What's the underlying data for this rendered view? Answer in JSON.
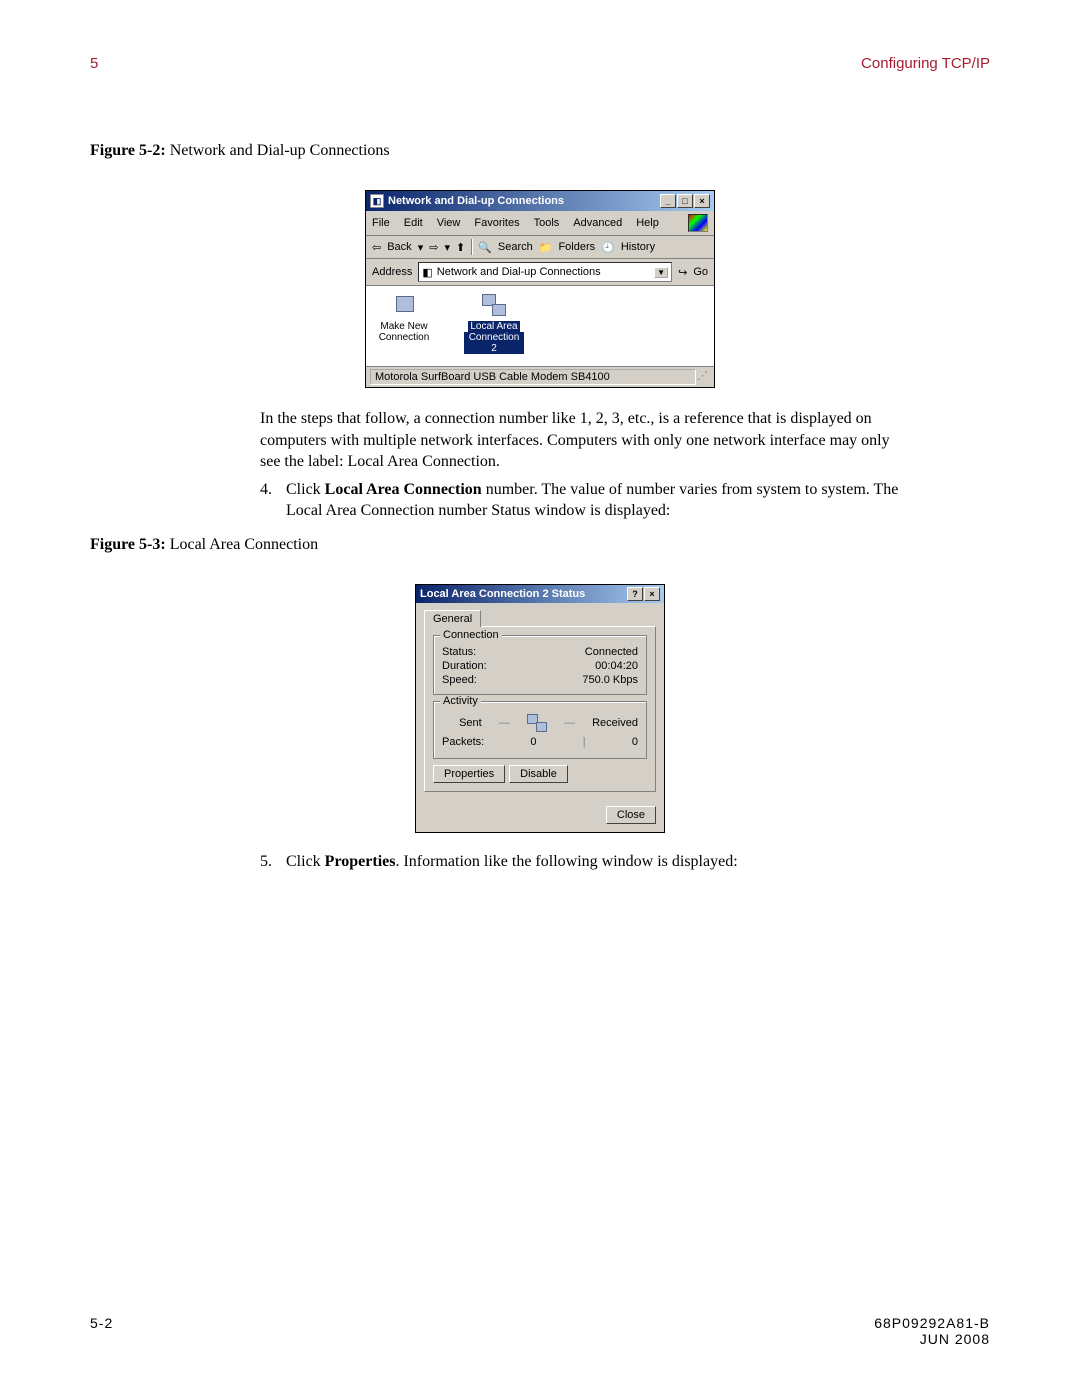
{
  "header": {
    "chapter": "5",
    "title": "Configuring TCP/IP"
  },
  "fig1_caption": {
    "label": "Figure 5-2:",
    "text": "Network and Dial-up Connections"
  },
  "win1": {
    "title": "Network and Dial-up Connections",
    "menu": [
      "File",
      "Edit",
      "View",
      "Favorites",
      "Tools",
      "Advanced",
      "Help"
    ],
    "toolbar": {
      "back": "Back",
      "search": "Search",
      "folders": "Folders",
      "history": "History"
    },
    "addr_label": "Address",
    "addr_value": "Network and Dial-up Connections",
    "go": "Go",
    "items": [
      {
        "line1": "Make New",
        "line2": "Connection"
      },
      {
        "line1": "Local Area",
        "line2": "Connection 2"
      }
    ],
    "status": "Motorola SurfBoard USB Cable Modem SB4100"
  },
  "para1": "In the steps that follow, a connection number like 1, 2, 3, etc., is a reference that is displayed on computers with multiple network interfaces. Computers with only one network interface may only see the label: Local Area Connection.",
  "step4": {
    "num": "4.",
    "pre": "Click ",
    "bold": "Local Area Connection",
    "post": " number. The value of number varies from system to system. The Local Area Connection number Status window is displayed:"
  },
  "fig2_caption": {
    "label": "Figure 5-3:",
    "text": "Local Area Connection"
  },
  "dlg": {
    "title": "Local Area Connection 2 Status",
    "tab": "General",
    "grp_conn": "Connection",
    "status_k": "Status:",
    "status_v": "Connected",
    "duration_k": "Duration:",
    "duration_v": "00:04:20",
    "speed_k": "Speed:",
    "speed_v": "750.0 Kbps",
    "grp_act": "Activity",
    "sent": "Sent",
    "received": "Received",
    "packets_k": "Packets:",
    "packets_sent": "0",
    "packets_recv": "0",
    "btn_props": "Properties",
    "btn_disable": "Disable",
    "btn_close": "Close"
  },
  "step5": {
    "num": "5.",
    "pre": "Click ",
    "bold": "Properties",
    "post": ". Information like the following window is displayed:"
  },
  "footer": {
    "left": "5-2",
    "right1": "68P09292A81-B",
    "right2": "JUN 2008"
  }
}
